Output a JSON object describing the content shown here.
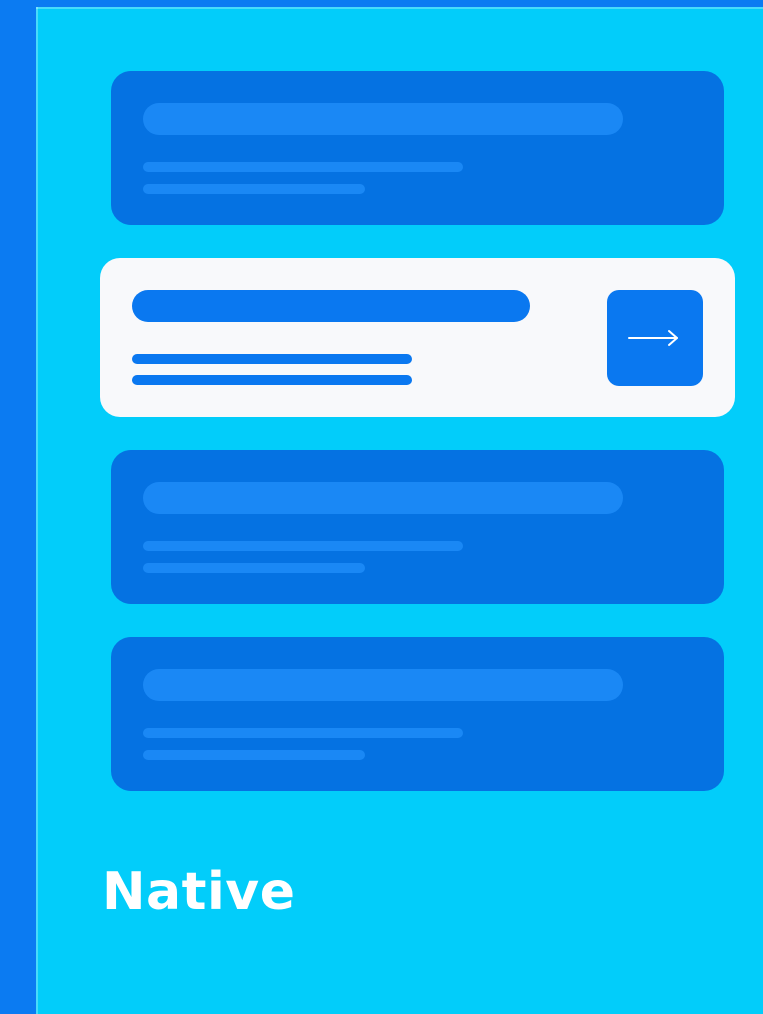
{
  "label": "Native",
  "cards": [
    {
      "state": "placeholder"
    },
    {
      "state": "active",
      "action_icon": "arrow-right-icon"
    },
    {
      "state": "placeholder"
    },
    {
      "state": "placeholder"
    }
  ],
  "colors": {
    "background": "#0b7bf2",
    "panel": "#02cdfa",
    "placeholder_card": "#0572e2",
    "placeholder_bar": "#1a88f5",
    "active_card": "#f8f9fb",
    "accent": "#0a78f0",
    "text": "#ffffff"
  }
}
